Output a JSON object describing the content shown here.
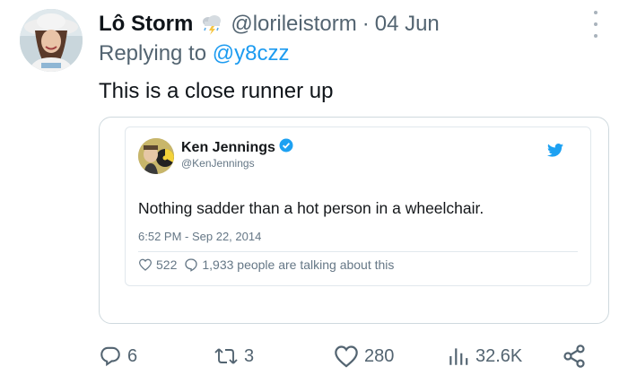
{
  "tweet": {
    "display_name": "Lô Storm",
    "name_emoji_icon": "cloud-lightning-rain-icon",
    "handle": "@lorileistorm",
    "separator": "·",
    "date": "04 Jun",
    "replying_prefix": "Replying to",
    "replying_to": "@y8czz",
    "text": "This is a close runner up"
  },
  "quoted_embed": {
    "name": "Ken Jennings",
    "handle": "@KenJennings",
    "text": "Nothing sadder than a hot person in a wheelchair.",
    "timestamp": "6:52 PM - Sep 22, 2014",
    "likes": "522",
    "talking": "1,933 people are talking about this",
    "bird_icon": "twitter-bird-icon",
    "verified_icon": "verified-badge-icon"
  },
  "actions": {
    "replies": "6",
    "retweets": "3",
    "likes": "280",
    "views": "32.6K"
  },
  "colors": {
    "accent": "#1d9bf0",
    "secondary_text": "#536471",
    "primary_text": "#0f1419",
    "border": "#cfd9de"
  }
}
